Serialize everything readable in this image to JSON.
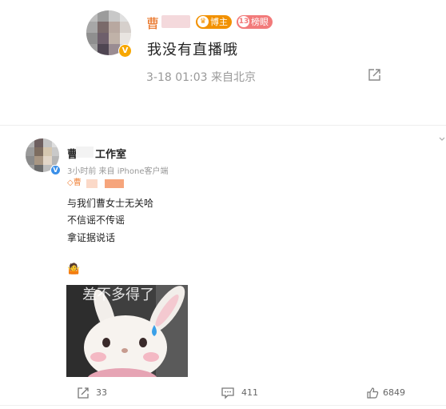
{
  "top_post": {
    "author_initial": "曹",
    "badge_boss": "博主",
    "badge_rank_level": "13",
    "badge_rank": "榜眼",
    "text": "我没有直播哦",
    "meta": "3-18 01:03  来自北京",
    "verified_icon": "v-badge-icon",
    "share_icon": "share-icon"
  },
  "second_post": {
    "author_prefix": "曹",
    "author_suffix": "工作室",
    "meta": "3小时前  来自 iPhone客户端",
    "fan_prefix": "曹",
    "lines": [
      "与我们曹女士无关哈",
      "不信谣不传谣",
      "拿证据说话"
    ],
    "image_caption": "差不多得了",
    "verified_icon": "v-badge-icon"
  },
  "actions": {
    "share_count": "33",
    "comment_count": "411",
    "like_count": "6849"
  },
  "colors": {
    "name_orange": "#e86c1b",
    "meta_gray": "#999999",
    "boss_badge": "#f29100",
    "rank_badge": "#f27a7a",
    "verified_blue": "#3a8fe8",
    "verified_gold": "#f7a700"
  }
}
